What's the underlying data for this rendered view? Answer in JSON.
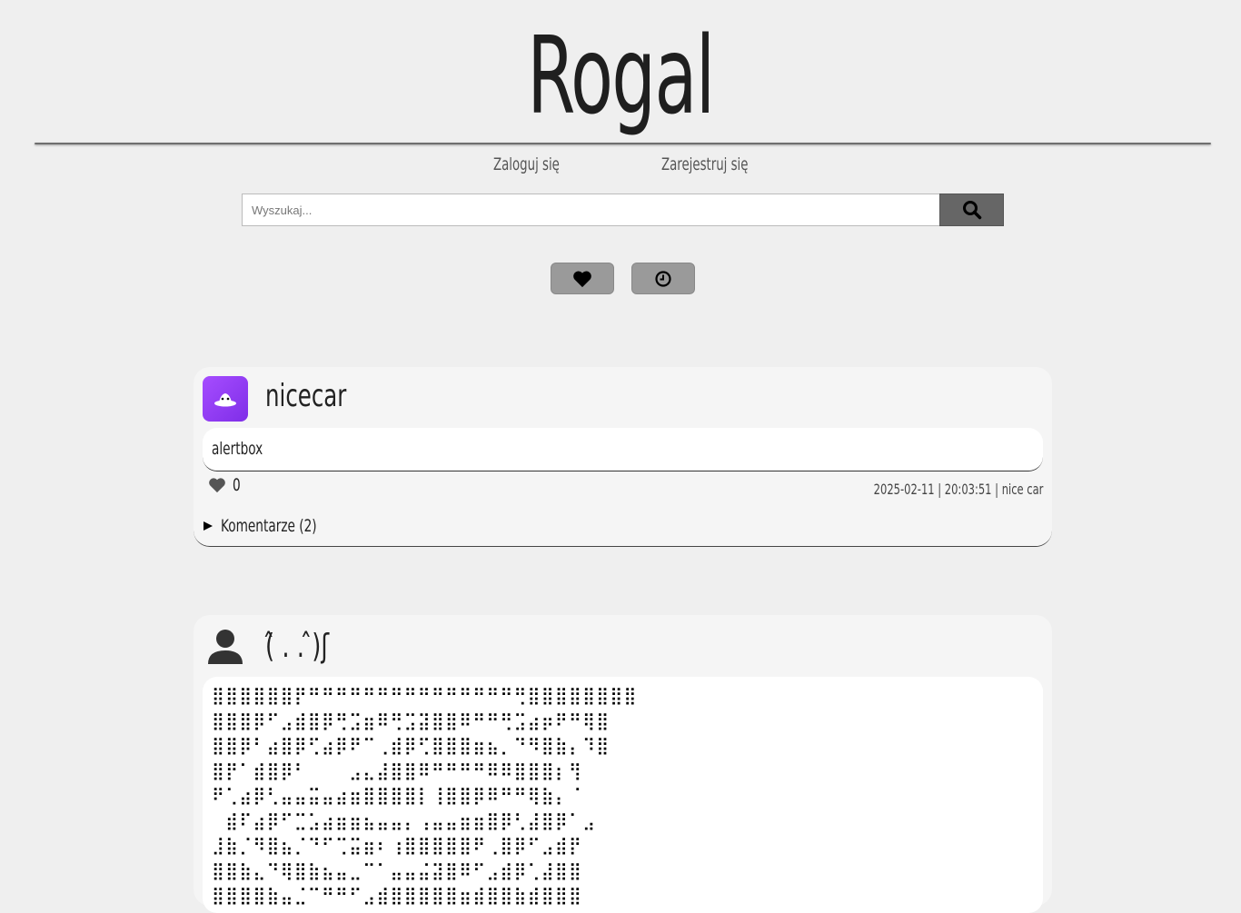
{
  "header": {
    "title": "Rogal"
  },
  "nav": {
    "login": "Zaloguj się",
    "register": "Zarejestruj się"
  },
  "search": {
    "placeholder": "Wyszukaj...",
    "value": "",
    "button_icon": "search-icon"
  },
  "filters": [
    {
      "icon": "heart-icon"
    },
    {
      "icon": "clock-icon"
    }
  ],
  "posts": [
    {
      "username": "nicecar",
      "avatar": "avatar-image",
      "content": "alertbox",
      "likes": "0",
      "meta": "2025-02-11 | 20:03:51 | nice car",
      "comments_label": "Komentarze (2)"
    },
    {
      "username": "(̂ . . ̂)ʃ",
      "avatar": "user-icon",
      "ascii_art": "⣿⣿⣿⣿⣿⣿⡟⠛⠛⠛⠛⠛⠛⠛⠛⠛⠛⠛⠛⠛⠛⠛⢛⣿⣿⣿⣿⣿⣿⣿⣿\n⣿⣿⣿⡿⠋⣠⣾⣿⡿⢛⣩⣶⠿⢛⣩⣽⣿⣿⠿⠛⠛⢛⣩⣴⡶⠟⠛⢿⣿\n⣿⣿⡿⠃⣴⣿⡿⢋⣴⡿⠟⠉⢀⣾⡿⢋⣿⣿⣿⣶⣦⡀⠙⠻⣿⣷⡄⠹⣿\n⣿⡟⠁⣾⣿⡿⠃⠀⠀⠀⣠⣄⣼⣿⣿⠿⠛⠛⠛⠛⠿⠿⣿⣿⣿⡆⢻\n⠟⢁⣴⡿⢃⣤⣤⣭⣤⣴⣶⣿⣿⣿⣿⡇⢸⣿⣿⡿⠿⠛⠛⢿⣷⡄⠈\n⠀⣾⠏⣴⡿⠋⣉⣡⣴⣶⣶⣦⣤⣤⡄⢠⣤⣤⣶⣶⣿⡿⢃⣼⣿⡿⠁⣠\n⣸⣷⡈⠻⣿⣦⡈⠙⠋⢉⣭⣶⠆⢰⣿⣿⣿⣿⣿⠟⢀⣿⡿⠋⣠⣾⡟\n⣿⣿⣷⣄⠙⢿⣿⣷⣦⣤⣀⠉⠁⣤⣤⣬⣽⣿⠿⠋⣠⣾⡿⢁⣼⣿⣿\n⣿⣿⣿⣿⣷⣤⣈⠉⠛⠛⠋⣠⣾⣿⣿⣿⣿⣿⣶⣾⣿⣿⣷⣾⣿⣿⣿"
    }
  ]
}
